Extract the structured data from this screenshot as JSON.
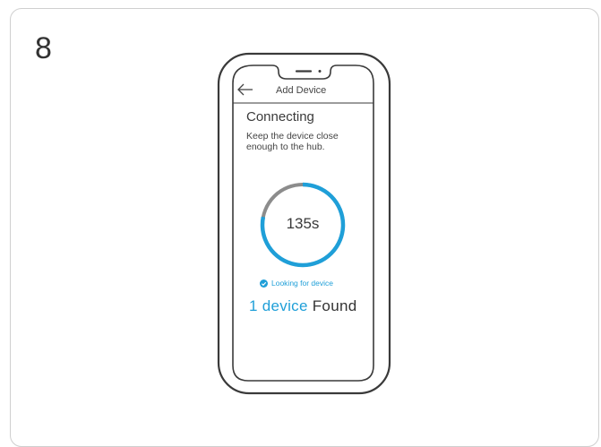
{
  "step": {
    "number": "8"
  },
  "phone": {
    "nav": {
      "title": "Add Device",
      "back_icon": "back-arrow-icon"
    },
    "heading": "Connecting",
    "instruction": "Keep the device close enough to the hub.",
    "countdown": {
      "text": "135s",
      "progress_fraction": 0.78
    },
    "status": {
      "icon": "check-circle-icon",
      "label": "Looking for device"
    },
    "result": {
      "count_text": "1 device",
      "found_text": "Found"
    }
  },
  "colors": {
    "accent": "#1f9fd8",
    "ring_track": "#8c8c8c",
    "outline": "#3a3a3a"
  }
}
